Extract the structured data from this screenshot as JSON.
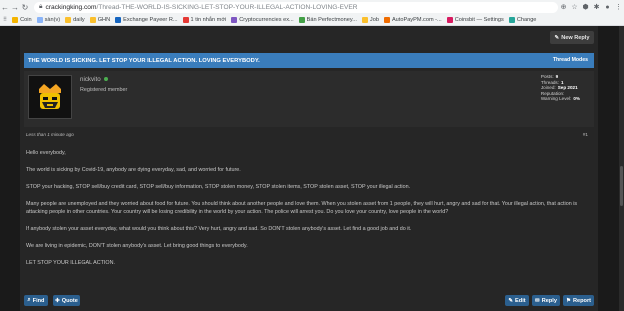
{
  "browser": {
    "url_host": "crackingking.com",
    "url_path": "/Thread-THE-WORLD-IS-SICKING-LET-STOP-YOUR-ILLEGAL-ACTION-LOVING-EVER",
    "bookmarks": [
      {
        "label": "Coin",
        "color": "#f4b400"
      },
      {
        "label": "sàn(v)",
        "color": "#8ab4f8"
      },
      {
        "label": "daily",
        "color": "#fbc02d"
      },
      {
        "label": "GHN",
        "color": "#fbc02d"
      },
      {
        "label": "Exchange Payeer R...",
        "color": "#1565c0"
      },
      {
        "label": "1 tin nhắn mới",
        "color": "#e53935"
      },
      {
        "label": "Cryptocurrencies ex...",
        "color": "#7e57c2"
      },
      {
        "label": "Bán Perfectmoney...",
        "color": "#43a047"
      },
      {
        "label": "Job",
        "color": "#fbc02d"
      },
      {
        "label": "AutoPayPM.com -...",
        "color": "#ef6c00"
      },
      {
        "label": "Coinsbit — Settings",
        "color": "#d81b60"
      },
      {
        "label": "Change",
        "color": "#26a69a"
      }
    ]
  },
  "toolbar": {
    "new_reply": "New Reply"
  },
  "thread": {
    "title": "THE WORLD IS SICKING. LET STOP YOUR ILLEGAL ACTION. LOVING EVERYBODY.",
    "modes": "Thread Modes"
  },
  "author": {
    "name": "nickvito",
    "role": "Registered member",
    "stats": [
      {
        "label": "Posts:",
        "value": "9"
      },
      {
        "label": "Threads:",
        "value": "1"
      },
      {
        "label": "Joined:",
        "value": "Sep 2021"
      },
      {
        "label": "Reputation:",
        "value": ""
      },
      {
        "label": "Warning Level:",
        "value": "0%"
      }
    ]
  },
  "post": {
    "date": "Less than 1 minute ago",
    "number": "#1",
    "paragraphs": [
      "Hello everybody,",
      "The world is sicking by Covid-19, anybody are dying everyday, sad, and worried for future.",
      "STOP your hacking, STOP sell/buy credit card, STOP sell/buy information, STOP stolen money, STOP stolen items, STOP stolen asset, STOP your illegal action.",
      "Many people are unemployed and they worried about food for future. You should think about another people and love them. When you stolen asset from 1 people, they will hurt, angry and sad for that. Your illegal action, that action is attacking people in other countries. Your country will be losing credibility in the world by your action. The police will arrest you. Do you love your country, love people in the world?",
      "If anybody stolen your asset everyday, what would you think about this? Very hurt, angry and sad. So DON'T stolen anybody's asset. Let find a good job and do it.",
      "We are living in epidemic, DON'T stolen anybody's asset. Let bring good things to everybody.",
      "LET STOP YOUR ILLEGAL ACTION."
    ]
  },
  "actions": {
    "find": "Find",
    "quote": "Quote",
    "edit": "Edit",
    "reply": "Reply",
    "report": "Report"
  }
}
